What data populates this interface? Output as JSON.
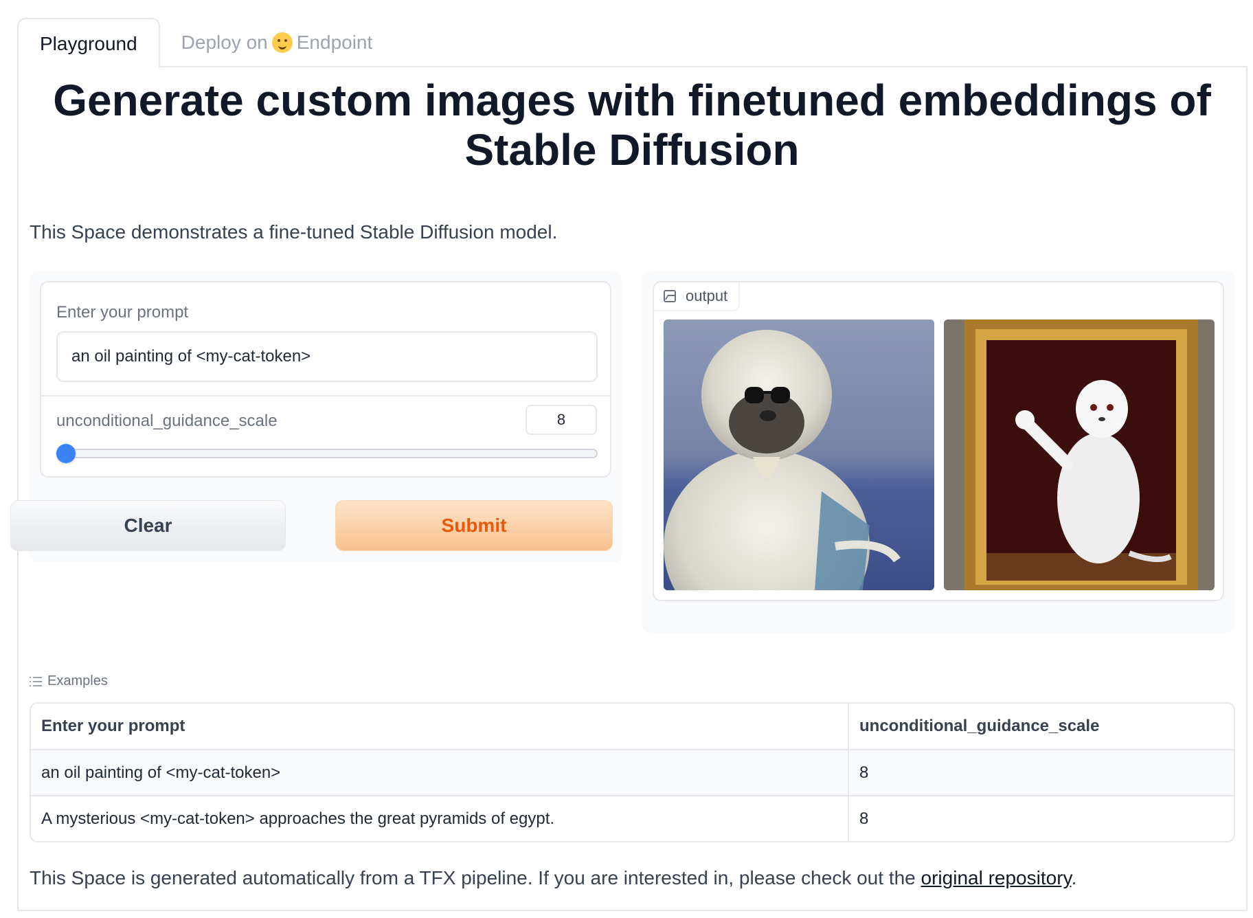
{
  "tabs": {
    "playground": "Playground",
    "deploy_prefix": "Deploy on",
    "deploy_suffix": "Endpoint"
  },
  "title": "Generate custom images with finetuned embeddings of Stable Diffusion",
  "description": "This Space demonstrates a fine-tuned Stable Diffusion model.",
  "form": {
    "prompt_label": "Enter your prompt",
    "prompt_value": "an oil painting of <my-cat-token>",
    "slider_label": "unconditional_guidance_scale",
    "slider_value": "8",
    "slider_fraction": 0.0,
    "clear_label": "Clear",
    "submit_label": "Submit"
  },
  "output": {
    "label": "output",
    "images": [
      "image-icon",
      "image-icon"
    ]
  },
  "examples": {
    "label": "Examples",
    "headers": [
      "Enter your prompt",
      "unconditional_guidance_scale"
    ],
    "rows": [
      [
        "an oil painting of <my-cat-token>",
        "8"
      ],
      [
        "A mysterious <my-cat-token> approaches the great pyramids of egypt.",
        "8"
      ]
    ]
  },
  "footer": {
    "text": "This Space is generated automatically from a TFX pipeline. If you are interested in, please check out the",
    "link": "original repository",
    "end": "."
  },
  "colors": {
    "accent": "#3b82f6",
    "submit_text": "#ea580c"
  }
}
